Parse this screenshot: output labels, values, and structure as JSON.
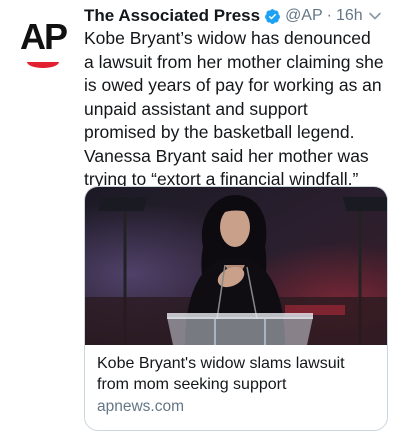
{
  "author": {
    "avatar_logo": "AP",
    "display_name": "The Associated Press",
    "handle": "@AP",
    "separator": "·",
    "time": "16h"
  },
  "tweet": {
    "text": "Kobe Bryant’s widow has denounced a lawsuit from her mother claiming she is owed years of pay for working as an unpaid assistant and support promised by the basketball legend. Vanessa Bryant said her mother was trying to “extort a financial windfall.”"
  },
  "card": {
    "title": "Kobe Bryant's widow slams lawsuit from mom seeking support",
    "domain": "apnews.com",
    "image_icon": "photo-woman-at-podium"
  },
  "colors": {
    "text": "#14171a",
    "secondary": "#657786",
    "verified_blue": "#1da1f2",
    "ap_red": "#e2202f",
    "card_border": "#ccd6dd"
  }
}
